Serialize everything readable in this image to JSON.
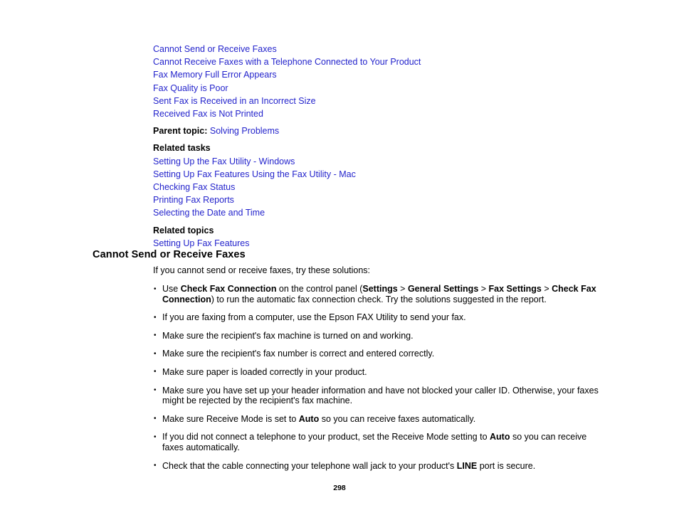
{
  "document": {
    "page_number": "298",
    "link_color": "#2424CC",
    "text_color": "#000000",
    "background_color": "#ffffff"
  },
  "toc_links": [
    {
      "label": "Cannot Send or Receive Faxes"
    },
    {
      "label": "Cannot Receive Faxes with a Telephone Connected to Your Product"
    },
    {
      "label": "Fax Memory Full Error Appears"
    },
    {
      "label": "Fax Quality is Poor"
    },
    {
      "label": "Sent Fax is Received in an Incorrect Size"
    },
    {
      "label": "Received Fax is Not Printed"
    }
  ],
  "parent_topic": {
    "label": "Parent topic:",
    "link": "Solving Problems"
  },
  "related_tasks": {
    "heading": "Related tasks",
    "links": [
      {
        "label": "Setting Up the Fax Utility - Windows"
      },
      {
        "label": "Setting Up Fax Features Using the Fax Utility - Mac"
      },
      {
        "label": "Checking Fax Status"
      },
      {
        "label": "Printing Fax Reports"
      },
      {
        "label": "Selecting the Date and Time"
      }
    ]
  },
  "related_topics": {
    "heading": "Related topics",
    "links": [
      {
        "label": "Setting Up Fax Features"
      }
    ]
  },
  "section": {
    "heading": "Cannot Send or Receive Faxes",
    "intro": "If you cannot send or receive faxes, try these solutions:",
    "bullets": [
      {
        "id": "check-fax-connection",
        "parts": [
          {
            "text": "Use ",
            "bold": false
          },
          {
            "text": "Check Fax Connection",
            "bold": true
          },
          {
            "text": " on the control panel (",
            "bold": false
          },
          {
            "text": "Settings",
            "bold": true
          },
          {
            "text": " > ",
            "bold": false
          },
          {
            "text": "General Settings",
            "bold": true
          },
          {
            "text": " > ",
            "bold": false
          },
          {
            "text": "Fax Settings",
            "bold": true
          },
          {
            "text": " > ",
            "bold": false
          },
          {
            "text": "Check Fax Connection",
            "bold": true
          },
          {
            "text": ") to run the automatic fax connection check. Try the solutions suggested in the report.",
            "bold": false
          }
        ]
      },
      {
        "id": "faxing-from-computer",
        "parts": [
          {
            "text": "If you are faxing from a computer, use the Epson FAX Utility to send your fax.",
            "bold": false
          }
        ]
      },
      {
        "id": "recipient-machine-on",
        "parts": [
          {
            "text": "Make sure the recipient's fax machine is turned on and working.",
            "bold": false
          }
        ]
      },
      {
        "id": "recipient-number-correct",
        "parts": [
          {
            "text": "Make sure the recipient's fax number is correct and entered correctly.",
            "bold": false
          }
        ]
      },
      {
        "id": "paper-loaded",
        "parts": [
          {
            "text": "Make sure paper is loaded correctly in your product.",
            "bold": false
          }
        ]
      },
      {
        "id": "header-caller-id",
        "parts": [
          {
            "text": "Make sure you have set up your header information and have not blocked your caller ID. Otherwise, your faxes might be rejected by the recipient's fax machine.",
            "bold": false
          }
        ]
      },
      {
        "id": "receive-mode-auto",
        "parts": [
          {
            "text": "Make sure Receive Mode is set to ",
            "bold": false
          },
          {
            "text": "Auto",
            "bold": true
          },
          {
            "text": " so you can receive faxes automatically.",
            "bold": false
          }
        ]
      },
      {
        "id": "no-telephone-auto",
        "parts": [
          {
            "text": "If you did not connect a telephone to your product, set the Receive Mode setting to ",
            "bold": false
          },
          {
            "text": "Auto",
            "bold": true
          },
          {
            "text": " so you can receive faxes automatically.",
            "bold": false
          }
        ]
      },
      {
        "id": "line-port-secure",
        "parts": [
          {
            "text": "Check that the cable connecting your telephone wall jack to your product's ",
            "bold": false
          },
          {
            "text": "LINE",
            "bold": true
          },
          {
            "text": " port is secure.",
            "bold": false
          }
        ]
      }
    ]
  }
}
